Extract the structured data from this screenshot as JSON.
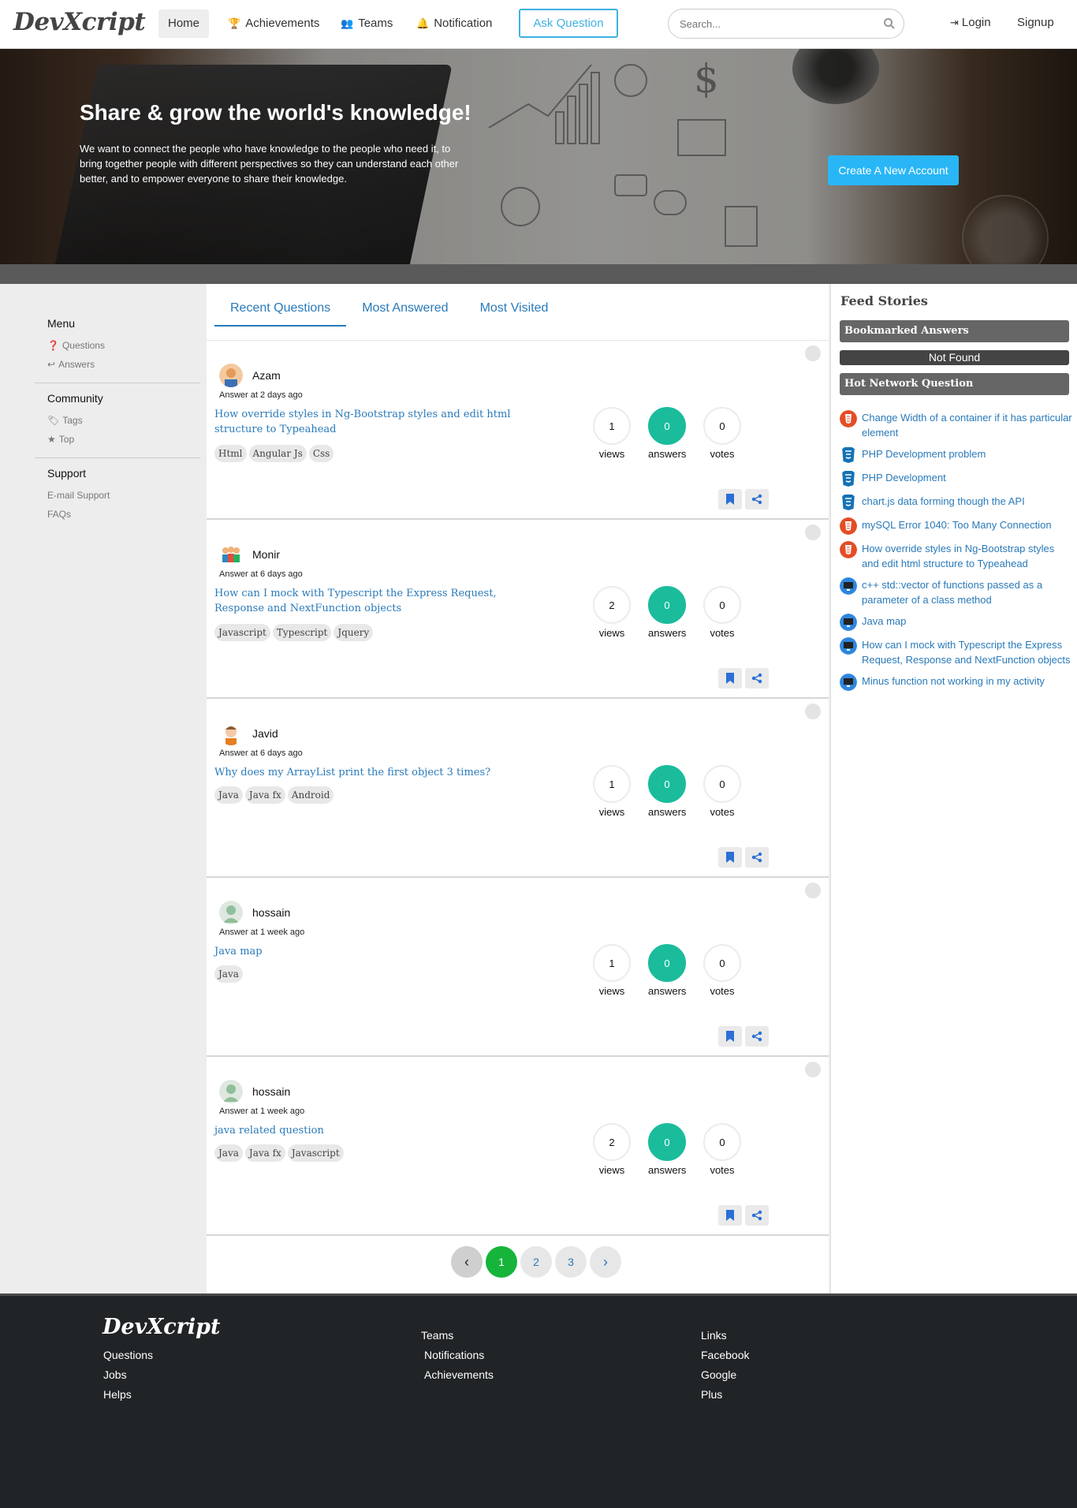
{
  "nav": {
    "brand": "DevXcript",
    "home": "Home",
    "achievements": "Achievements",
    "teams": "Teams",
    "notification": "Notification",
    "ask": "Ask Question",
    "search_placeholder": "Search...",
    "login": "Login",
    "signup": "Signup"
  },
  "hero": {
    "title": "Share & grow the world's knowledge!",
    "text": "We want to connect the people who have knowledge to the people who need it, to bring together people with different perspectives so they can understand each other better, and to empower everyone to share their knowledge.",
    "cta": "Create A New Account"
  },
  "left": {
    "menu": {
      "title": "Menu",
      "items": [
        "Questions",
        "Answers"
      ]
    },
    "community": {
      "title": "Community",
      "items": [
        "Tags",
        "Top"
      ]
    },
    "support": {
      "title": "Support",
      "items": [
        "E-mail Support",
        "FAQs"
      ]
    }
  },
  "tabs": [
    "Recent Questions",
    "Most Answered",
    "Most Visited"
  ],
  "questions": [
    {
      "name": "Azam",
      "time": "Answer at 2 days ago",
      "title": "How override styles in Ng-Bootstrap styles and edit html structure to Typeahead",
      "tags": [
        "Html",
        "Angular Js",
        "Css"
      ],
      "views": "1",
      "answers": "0",
      "votes": "0"
    },
    {
      "name": "Monir",
      "time": "Answer at 6 days ago",
      "title": "How can I mock with Typescript the Express Request, Response and NextFunction objects",
      "tags": [
        "Javascript",
        "Typescript",
        "Jquery"
      ],
      "views": "2",
      "answers": "0",
      "votes": "0"
    },
    {
      "name": "Javid",
      "time": "Answer at 6 days ago",
      "title": "Why does my ArrayList print the first object 3 times?",
      "tags": [
        "Java",
        "Java fx",
        "Android"
      ],
      "views": "1",
      "answers": "0",
      "votes": "0"
    },
    {
      "name": "hossain",
      "time": "Answer at 1 week ago",
      "title": "Java map",
      "tags": [
        "Java"
      ],
      "views": "1",
      "answers": "0",
      "votes": "0"
    },
    {
      "name": "hossain",
      "time": "Answer at 1 week ago",
      "title": "java related question",
      "tags": [
        "Java",
        "Java fx",
        "Javascript"
      ],
      "views": "2",
      "answers": "0",
      "votes": "0"
    }
  ],
  "stat_labels": {
    "views": "views",
    "answers": "answers",
    "votes": "votes"
  },
  "pager": {
    "prev": "‹",
    "pages": [
      "1",
      "2",
      "3"
    ],
    "next": "›"
  },
  "right": {
    "title": "Feed Stories",
    "bookmarked": "Bookmarked Answers",
    "not_found": "Not Found",
    "hot_title": "Hot Network Question",
    "hot": [
      {
        "text": "Change Width of a container if it has particular element",
        "icon": "html5-icon"
      },
      {
        "text": "PHP Development problem",
        "icon": "css3-icon"
      },
      {
        "text": "PHP Development",
        "icon": "css3-icon"
      },
      {
        "text": "chart.js data forming though the API",
        "icon": "css3-icon"
      },
      {
        "text": "mySQL Error 1040: Too Many Connection",
        "icon": "html5-icon"
      },
      {
        "text": "How override styles in Ng-Bootstrap styles and edit html structure to Typeahead",
        "icon": "html5-icon"
      },
      {
        "text": "c++ std::vector of functions passed as a parameter of a class method",
        "icon": "monitor-icon"
      },
      {
        "text": "Java map",
        "icon": "monitor-icon"
      },
      {
        "text": "How can I mock with Typescript the Express Request, Response and NextFunction objects",
        "icon": "monitor-icon"
      },
      {
        "text": "Minus function not working in my activity",
        "icon": "monitor-icon"
      }
    ]
  },
  "footer": {
    "brand": "DevXcript",
    "col1": [
      "Questions",
      "Jobs",
      "Helps"
    ],
    "col2": [
      "Teams",
      "Notifications",
      "Achievements"
    ],
    "col3": [
      "Links",
      "Facebook",
      "Google",
      "Plus"
    ]
  },
  "colors": {
    "accent": "#2a7ab9",
    "ask_border": "#3fb1e2",
    "cta": "#29b6f6",
    "answers_green": "#1abc9c",
    "pager_current": "#16b43a",
    "footer_bg": "#202426"
  }
}
